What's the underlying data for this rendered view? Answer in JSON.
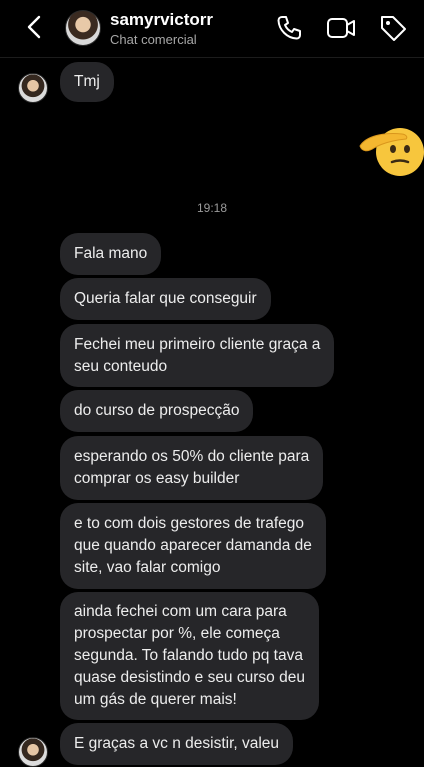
{
  "header": {
    "username": "samyrvictorr",
    "subtitle": "Chat comercial"
  },
  "timestamp": "19:18",
  "messages": [
    {
      "text": "Tmj"
    },
    {
      "text": "Fala mano"
    },
    {
      "text": "Queria falar que conseguir"
    },
    {
      "text": "Fechei meu primeiro cliente graça a\nseu conteudo"
    },
    {
      "text": "do curso de prospecção"
    },
    {
      "text": "esperando os 50% do cliente para\ncomprar os easy builder"
    },
    {
      "text": "e to com dois gestores de trafego\nque quando aparecer damanda de\nsite, vao falar comigo"
    },
    {
      "text": "ainda fechei com um cara para\nprospectar por %, ele começa\nsegunda. To falando tudo pq tava\nquase desistindo e seu curso deu\num gás de querer mais!"
    },
    {
      "text": "E graças a vc n desistir, valeu"
    }
  ],
  "icons": {
    "back": "chevron-left-icon",
    "call": "phone-icon",
    "video": "video-camera-icon",
    "tag": "tag-icon",
    "reaction": "saluting-face-emoji"
  }
}
